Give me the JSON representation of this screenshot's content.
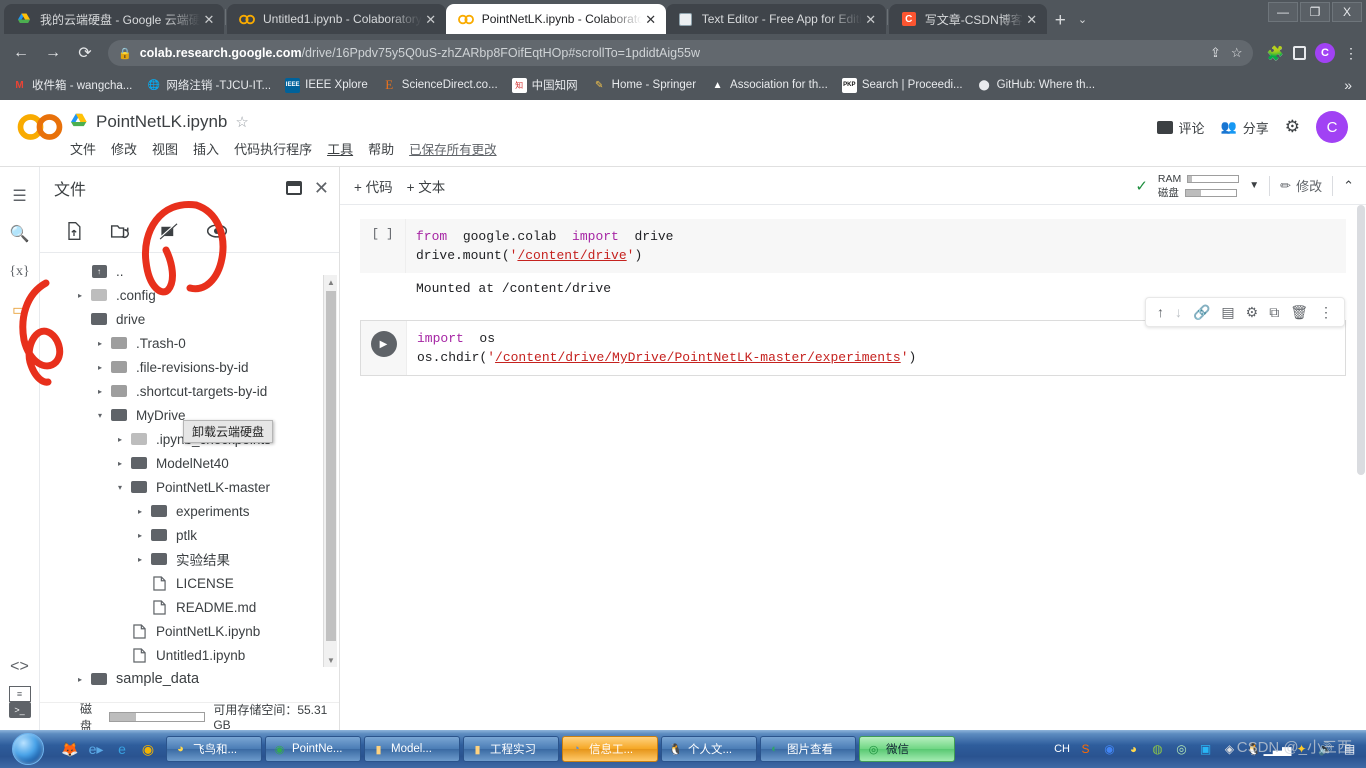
{
  "browser": {
    "tabs": [
      {
        "title": "我的云端硬盘 - Google 云端硬盘",
        "favicon": "drive-icon",
        "active": false
      },
      {
        "title": "Untitled1.ipynb - Colaboratory",
        "favicon": "colab-icon",
        "active": false
      },
      {
        "title": "PointNetLK.ipynb - Colaboratory",
        "favicon": "colab-icon",
        "active": true
      },
      {
        "title": "Text Editor - Free App for Editing",
        "favicon": "texteditor-icon",
        "active": false
      },
      {
        "title": "写文章-CSDN博客",
        "favicon": "csdn-icon",
        "active": false
      }
    ],
    "new_tab_label": "+",
    "window_controls": {
      "minimize": "—",
      "maximize": "❐",
      "close": "X"
    },
    "nav": {
      "back": "←",
      "forward": "→",
      "reload": "⟳"
    },
    "url_domain": "colab.research.google.com",
    "url_path": "/drive/16Ppdv75y5Q0uS-zhZARbp8FOifEqtHOp#scrollTo=1pdidtAig55w",
    "profile_initial": "C",
    "bookmarks": [
      {
        "label": "收件箱 - wangcha...",
        "icon": "gmail-icon"
      },
      {
        "label": "网络注销 -TJCU-IT...",
        "icon": "globe-icon"
      },
      {
        "label": "IEEE Xplore",
        "icon": "ieee-icon"
      },
      {
        "label": "ScienceDirect.co...",
        "icon": "elsevier-icon"
      },
      {
        "label": "中国知网",
        "icon": "cnki-icon"
      },
      {
        "label": "Home - Springer",
        "icon": "springer-icon"
      },
      {
        "label": "Association for th...",
        "icon": "acm-icon"
      },
      {
        "label": "Search | Proceedi...",
        "icon": "pkp-icon"
      },
      {
        "label": "GitHub: Where th...",
        "icon": "github-icon"
      }
    ],
    "bookmarks_overflow": "»"
  },
  "colab": {
    "notebook_title": "PointNetLK.ipynb",
    "star": "☆",
    "menus": [
      "文件",
      "修改",
      "视图",
      "插入",
      "代码执行程序",
      "工具",
      "帮助"
    ],
    "save_status": "已保存所有更改",
    "header_actions": {
      "comment": "评论",
      "share": "分享",
      "settings_icon": "gear-icon",
      "avatar_initial": "C"
    },
    "toolbar": {
      "add_code": "+ 代码",
      "add_text": "+ 文本"
    },
    "resources": {
      "status_icon": "check-icon",
      "ram_label": "RAM",
      "disk_label": "磁盘",
      "ram_fill_pct": 6,
      "disk_fill_pct": 30,
      "dropdown_icon": "chevron-down-icon",
      "edit_label": "修改",
      "collapse_icon": "chevron-up-icon"
    },
    "files_panel": {
      "title": "文件",
      "menu_icon": "hamburger-icon",
      "open_new_window_icon": "open-in-new-icon",
      "close_icon": "close-icon",
      "tools": [
        {
          "name": "upload-icon",
          "glyph": "upload"
        },
        {
          "name": "new-folder-icon",
          "glyph": "refresh-folder"
        },
        {
          "name": "unmount-drive-icon",
          "glyph": "drive-off"
        },
        {
          "name": "toggle-hidden-icon",
          "glyph": "eye"
        }
      ],
      "tooltip": "卸载云端硬盘",
      "tree": [
        {
          "label": "..",
          "depth": 0,
          "type": "up",
          "arrow": ""
        },
        {
          "label": ".config",
          "depth": 0,
          "type": "folder-light",
          "arrow": "▸"
        },
        {
          "label": "drive",
          "depth": 0,
          "type": "folder-dark",
          "arrow": "▾"
        },
        {
          "label": ".Trash-0",
          "depth": 1,
          "type": "folder-light",
          "arrow": "▸"
        },
        {
          "label": ".file-revisions-by-id",
          "depth": 1,
          "type": "folder-light",
          "arrow": "▸"
        },
        {
          "label": ".shortcut-targets-by-id",
          "depth": 1,
          "type": "folder-light",
          "arrow": "▸"
        },
        {
          "label": "MyDrive",
          "depth": 1,
          "type": "folder-dark",
          "arrow": "▾"
        },
        {
          "label": ".ipynb_checkpoints",
          "depth": 2,
          "type": "folder-light",
          "arrow": "▸"
        },
        {
          "label": "ModelNet40",
          "depth": 2,
          "type": "folder-dark",
          "arrow": "▸"
        },
        {
          "label": "PointNetLK-master",
          "depth": 2,
          "type": "folder-dark",
          "arrow": "▾"
        },
        {
          "label": "experiments",
          "depth": 3,
          "type": "folder-dark",
          "arrow": "▸"
        },
        {
          "label": "ptlk",
          "depth": 3,
          "type": "folder-dark",
          "arrow": "▸"
        },
        {
          "label": "实验结果",
          "depth": 3,
          "type": "folder-dark",
          "arrow": "▸"
        },
        {
          "label": "LICENSE",
          "depth": 3,
          "type": "file",
          "arrow": ""
        },
        {
          "label": "README.md",
          "depth": 3,
          "type": "file",
          "arrow": ""
        },
        {
          "label": "PointNetLK.ipynb",
          "depth": 2,
          "type": "file",
          "arrow": ""
        },
        {
          "label": "Untitled1.ipynb",
          "depth": 2,
          "type": "file",
          "arrow": ""
        },
        {
          "label": "sample_data",
          "depth": 0,
          "type": "folder-dark",
          "arrow": "▸"
        }
      ],
      "disk_label": "磁盘",
      "disk_free_text": "可用存储空间：55.31 GB",
      "disk_fill_pct": 28
    },
    "rail_icons": [
      "hamburger-icon",
      "search-icon",
      "variables-icon",
      "folder-icon",
      "code-snippets-icon",
      "toc-icon",
      "terminal-icon"
    ],
    "cells": [
      {
        "prompt": "[ ]",
        "executed": false,
        "lines": [
          {
            "parts": [
              {
                "t": "kw",
                "v": "from"
              },
              {
                "t": "p",
                "v": "  google.colab  "
              },
              {
                "t": "kw",
                "v": "import"
              },
              {
                "t": "p",
                "v": "  drive"
              }
            ]
          },
          {
            "parts": [
              {
                "t": "p",
                "v": "drive.mount("
              },
              {
                "t": "str",
                "v": "'"
              },
              {
                "t": "link",
                "v": "/content/drive"
              },
              {
                "t": "str",
                "v": "'"
              },
              {
                "t": "p",
                "v": ")"
              }
            ]
          }
        ],
        "output": "Mounted at /content/drive"
      },
      {
        "prompt": "play",
        "executed": true,
        "selected": true,
        "lines": [
          {
            "parts": [
              {
                "t": "kw",
                "v": "import"
              },
              {
                "t": "p",
                "v": "  os"
              }
            ]
          },
          {
            "parts": [
              {
                "t": "p",
                "v": "os.chdir("
              },
              {
                "t": "str",
                "v": "'"
              },
              {
                "t": "link",
                "v": "/content/drive/MyDrive/PointNetLK-master/experiments"
              },
              {
                "t": "str",
                "v": "'"
              },
              {
                "t": "p",
                "v": ")"
              }
            ]
          }
        ],
        "output": ""
      }
    ],
    "cell_toolbar_icons": [
      "move-up-icon",
      "move-down-icon",
      "link-icon",
      "comment-icon",
      "settings-icon",
      "mirror-cell-icon",
      "delete-icon",
      "more-vert-icon"
    ]
  },
  "taskbar": {
    "start_label": "start-orb",
    "quick_launch": [
      "firefox-icon",
      "ie-quick-icon",
      "ie-icon",
      "chrome-icon"
    ],
    "buttons": [
      {
        "label": "飞鸟和...",
        "icon": "app-icon",
        "style": "normal"
      },
      {
        "label": "PointNe...",
        "icon": "chrome-icon",
        "style": "normal"
      },
      {
        "label": "Model...",
        "icon": "folder-icon",
        "style": "normal"
      },
      {
        "label": "工程实习",
        "icon": "folder-icon",
        "style": "normal"
      },
      {
        "label": "信息工...",
        "icon": "app-icon",
        "style": "active"
      },
      {
        "label": "个人文...",
        "icon": "qq-icon",
        "style": "normal"
      },
      {
        "label": "图片查看",
        "icon": "viewer-icon",
        "style": "normal"
      },
      {
        "label": "微信",
        "icon": "wechat-icon",
        "style": "green"
      }
    ],
    "tray": {
      "ime": "CH",
      "icons": [
        "sogou-icon",
        "chrome-tray-icon",
        "app1-icon",
        "app2-icon",
        "wechat-tray-icon",
        "blue-icon",
        "shield-icon",
        "qq-tray-icon",
        "network-icon",
        "update-icon",
        "volume-icon",
        "action-icon"
      ]
    },
    "watermark": "CSDN @_小三西"
  }
}
